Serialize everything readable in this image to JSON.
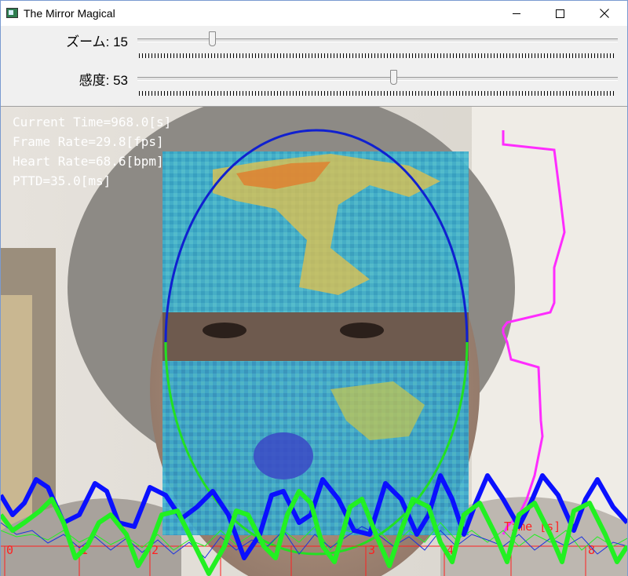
{
  "window": {
    "title": "The Mirror Magical",
    "icon": "app-icon",
    "controls": [
      "minimize-icon",
      "maximize-icon",
      "close-icon"
    ]
  },
  "trackbars": {
    "zoom": {
      "label": "ズーム: 15",
      "value": 15
    },
    "sensitivity": {
      "label": "感度: 53",
      "value": 53
    }
  },
  "hud": {
    "current_time": "Current Time=968.0[s]",
    "frame_rate": "Frame Rate=29.8[fps]",
    "heart_rate": "Heart Rate=68.6[bpm]",
    "pttd": "PTTD=35.0[ms]"
  },
  "plot": {
    "time_axis_label": "Time [s]",
    "tick_labels": [
      "0",
      "1",
      "2",
      "3",
      "4",
      "5",
      "6",
      "7",
      "8"
    ]
  },
  "colors": {
    "face_ellipse_top": "#1020d0",
    "face_ellipse_bottom": "#22e022",
    "side_wave": "#ff2cff",
    "pulse_blue": "#0a10ff",
    "pulse_green": "#22f022",
    "axis_red": "#ff2020"
  }
}
